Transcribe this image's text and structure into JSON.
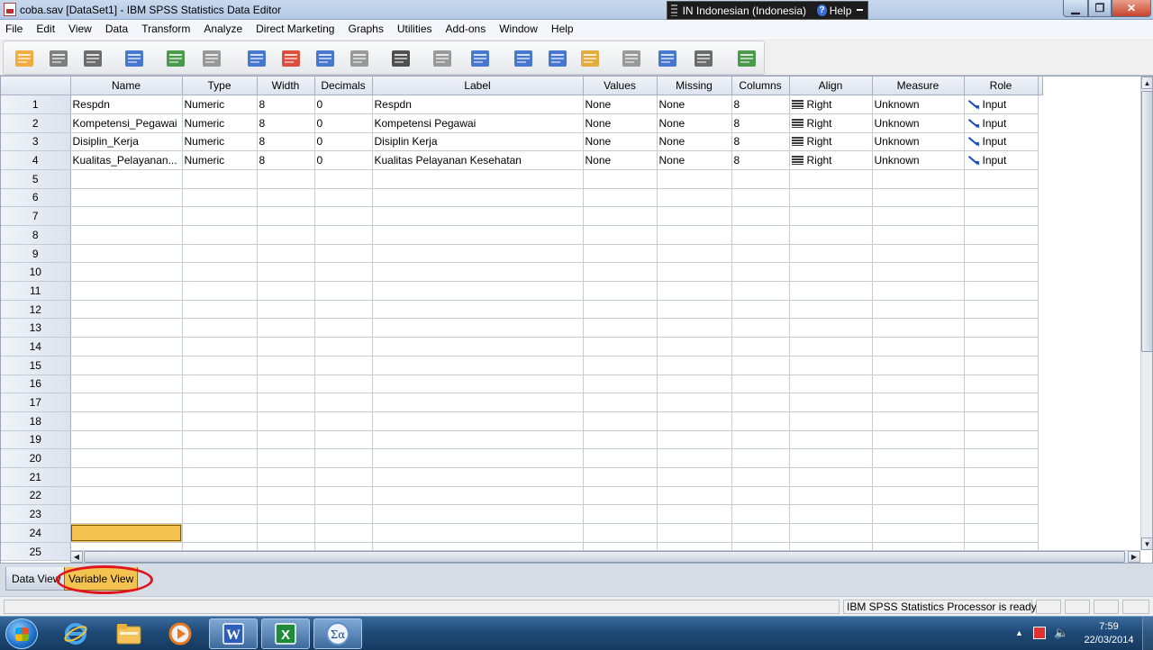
{
  "window": {
    "title": "coba.sav [DataSet1] - IBM SPSS Statistics Data Editor",
    "language": "IN Indonesian (Indonesia)",
    "help_label": "Help",
    "help_glyph": "?",
    "minimize_glyph": "▁",
    "maximize_glyph": "❐",
    "close_glyph": "✕"
  },
  "menu": [
    "File",
    "Edit",
    "View",
    "Data",
    "Transform",
    "Analyze",
    "Direct Marketing",
    "Graphs",
    "Utilities",
    "Add-ons",
    "Window",
    "Help"
  ],
  "toolbar": [
    {
      "name": "open-data-icon",
      "color": "#f0a020"
    },
    {
      "name": "save-icon",
      "color": "#6b6b6b"
    },
    {
      "name": "print-icon",
      "color": "#555555"
    },
    {
      "name": "recall-dialog-icon",
      "color": "#2a62c8"
    },
    {
      "name": "undo-icon",
      "color": "#2e8b2e"
    },
    {
      "name": "redo-icon",
      "color": "#888888"
    },
    {
      "name": "goto-case-icon",
      "color": "#2a62c8"
    },
    {
      "name": "goto-variable-icon",
      "color": "#d8321e"
    },
    {
      "name": "variables-icon",
      "color": "#2a62c8"
    },
    {
      "name": "run-descriptives-icon",
      "color": "#8a8a8a"
    },
    {
      "name": "find-icon",
      "color": "#333333"
    },
    {
      "name": "insert-cases-icon",
      "color": "#8a8a8a"
    },
    {
      "name": "insert-variable-icon",
      "color": "#2a62c8"
    },
    {
      "name": "split-file-icon",
      "color": "#2a62c8"
    },
    {
      "name": "weight-cases-icon",
      "color": "#2a62c8"
    },
    {
      "name": "select-cases-icon",
      "color": "#e0a020"
    },
    {
      "name": "value-labels-icon",
      "color": "#8a8a8a"
    },
    {
      "name": "use-variable-sets-icon",
      "color": "#2a62c8"
    },
    {
      "name": "show-all-variables-icon",
      "color": "#555555"
    },
    {
      "name": "spell-check-icon",
      "color": "#2e8b2e"
    }
  ],
  "grid": {
    "columns": [
      "Name",
      "Type",
      "Width",
      "Decimals",
      "Label",
      "Values",
      "Missing",
      "Columns",
      "Align",
      "Measure",
      "Role"
    ],
    "rows": [
      {
        "num": "1",
        "name": "Respdn",
        "type": "Numeric",
        "width": "8",
        "decimals": "0",
        "label": "Respdn",
        "values": "None",
        "missing": "None",
        "columns": "8",
        "align": "Right",
        "measure": "Unknown",
        "role": "Input"
      },
      {
        "num": "2",
        "name": "Kompetensi_Pegawai",
        "type": "Numeric",
        "width": "8",
        "decimals": "0",
        "label": "Kompetensi Pegawai",
        "values": "None",
        "missing": "None",
        "columns": "8",
        "align": "Right",
        "measure": "Unknown",
        "role": "Input"
      },
      {
        "num": "3",
        "name": "Disiplin_Kerja",
        "type": "Numeric",
        "width": "8",
        "decimals": "0",
        "label": "Disiplin Kerja",
        "values": "None",
        "missing": "None",
        "columns": "8",
        "align": "Right",
        "measure": "Unknown",
        "role": "Input"
      },
      {
        "num": "4",
        "name": "Kualitas_Pelayanan...",
        "type": "Numeric",
        "width": "8",
        "decimals": "0",
        "label": "Kualitas Pelayanan Kesehatan",
        "values": "None",
        "missing": "None",
        "columns": "8",
        "align": "Right",
        "measure": "Unknown",
        "role": "Input"
      }
    ],
    "empty_rows": [
      "5",
      "6",
      "7",
      "8",
      "9",
      "10",
      "11",
      "12",
      "13",
      "14",
      "15",
      "16",
      "17",
      "18",
      "19",
      "20",
      "21",
      "22",
      "23",
      "24",
      "25"
    ],
    "selected_row": "24",
    "selected_color": "#f4c24f"
  },
  "tabs": {
    "data_view": "Data View",
    "variable_view": "Variable View",
    "active": "variable_view",
    "highlight_color": "#e0141c"
  },
  "status": {
    "text": "IBM SPSS Statistics Processor is ready"
  },
  "taskbar": {
    "apps": [
      "internet-explorer-icon",
      "file-explorer-icon",
      "media-player-icon",
      "word-icon",
      "excel-icon",
      "spss-icon"
    ],
    "word_glyph": "W",
    "excel_glyph": "X",
    "spss_glyph": "Σα",
    "tray_arrow": "▲",
    "volume_glyph": "🔈",
    "time": "7:59",
    "date": "22/03/2014"
  }
}
